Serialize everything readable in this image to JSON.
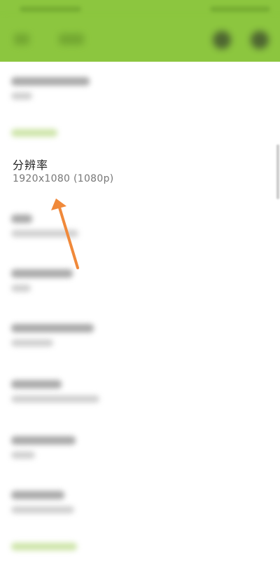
{
  "setting": {
    "title": "分辨率",
    "value": "1920x1080 (1080p)"
  },
  "icons": {
    "back": "back-arrow-icon",
    "action_1": "folder-icon",
    "action_2": "gear-icon",
    "annotation": "annotation-arrow"
  },
  "colors": {
    "app_bar": "#8cc63f",
    "annotation_arrow": "#f0893a",
    "category_text": "#c5e09a"
  }
}
